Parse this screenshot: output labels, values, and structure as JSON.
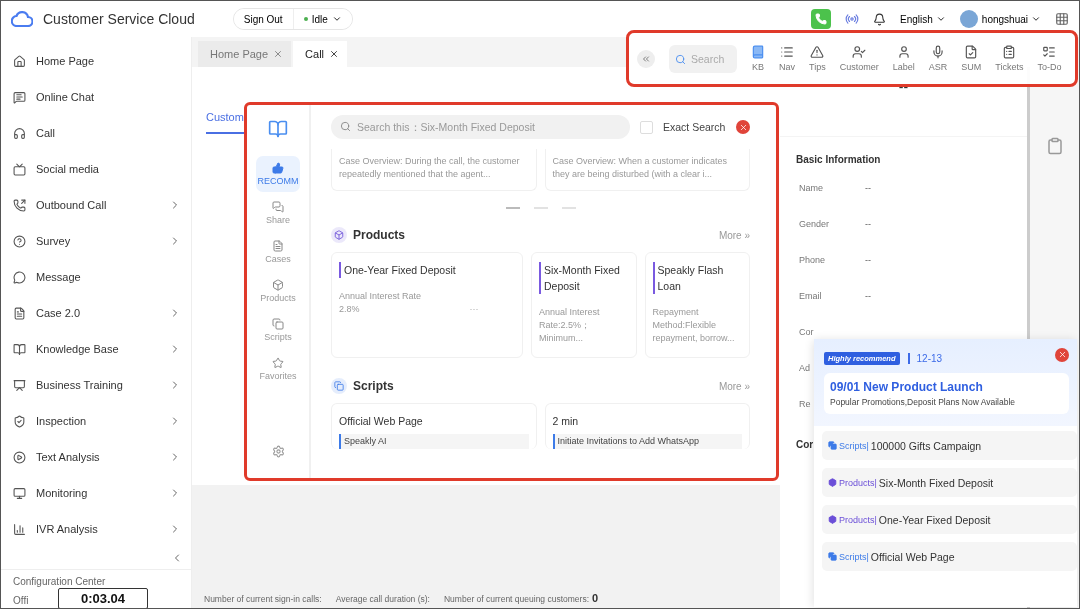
{
  "app": {
    "title": "Customer Service Cloud",
    "sign_out": "Sign Out",
    "status": "Idle",
    "language": "English",
    "user": "hongshuai"
  },
  "sidebar": {
    "items": [
      {
        "label": "Home Page",
        "expandable": false
      },
      {
        "label": "Online Chat",
        "expandable": false
      },
      {
        "label": "Call",
        "expandable": false
      },
      {
        "label": "Social media",
        "expandable": false
      },
      {
        "label": "Outbound Call",
        "expandable": true
      },
      {
        "label": "Survey",
        "expandable": true
      },
      {
        "label": "Message",
        "expandable": false
      },
      {
        "label": "Case 2.0",
        "expandable": true
      },
      {
        "label": "Knowledge Base",
        "expandable": true
      },
      {
        "label": "Business Training",
        "expandable": true
      },
      {
        "label": "Inspection",
        "expandable": true
      },
      {
        "label": "Text Analysis",
        "expandable": true
      },
      {
        "label": "Monitoring",
        "expandable": true
      },
      {
        "label": "IVR Analysis",
        "expandable": true
      }
    ],
    "bottom_items": [
      "Configuration Center",
      "Offi"
    ]
  },
  "tabs": [
    {
      "label": "Home Page",
      "selected": false
    },
    {
      "label": "Call",
      "selected": true
    }
  ],
  "workspace": {
    "tab": "Custom"
  },
  "stats": [
    {
      "label": "Number of current sign-in calls:"
    },
    {
      "label": "Average call duration (s):"
    },
    {
      "label": "Number of current queuing customers:",
      "value": "0"
    }
  ],
  "toolbar": {
    "search": {
      "placeholder": "Search"
    },
    "items": [
      {
        "label": "KB",
        "selected": true
      },
      {
        "label": "Nav",
        "selected": false
      },
      {
        "label": "Tips",
        "selected": false
      },
      {
        "label": "Customer",
        "selected": false
      },
      {
        "label": "Label",
        "selected": false
      },
      {
        "label": "ASR",
        "selected": false
      },
      {
        "label": "SUM",
        "selected": false
      },
      {
        "label": "Tickets",
        "selected": false
      },
      {
        "label": "To-Do",
        "selected": false
      }
    ]
  },
  "knowledge": {
    "nav": [
      {
        "label": "RECOMM",
        "selected": true
      },
      {
        "label": "Share",
        "selected": false
      },
      {
        "label": "Cases",
        "selected": false
      },
      {
        "label": "Products",
        "selected": false
      },
      {
        "label": "Scripts",
        "selected": false
      },
      {
        "label": "Favorites",
        "selected": false
      }
    ],
    "search": {
      "placeholder": "Search this：Six-Month Fixed Deposit"
    },
    "exact_search": {
      "label": "Exact Search",
      "checked": false
    },
    "cases": [
      {
        "text": "Case Overview: During the call, the customer repeatedly mentioned that the agent..."
      },
      {
        "text": "Case Overview: When a customer indicates they are being disturbed (with a clear i..."
      }
    ],
    "carousel": [
      {
        "selected": true
      },
      {
        "selected": false
      },
      {
        "selected": false
      }
    ],
    "sections": [
      {
        "title": "Products",
        "more": "More »",
        "kind": "products",
        "cards": [
          {
            "title": "One-Year Fixed Deposit",
            "text": "Annual Interest Rate\n2.8%",
            "extra": "···"
          },
          {
            "title": "Six-Month Fixed Deposit",
            "text": "Annual Interest Rate:2.5%；Minimum..."
          },
          {
            "title": "Speakly Flash Loan",
            "text": "Repayment Method:Flexible repayment, borrow..."
          }
        ]
      },
      {
        "title": "Scripts",
        "more": "More »",
        "kind": "scripts",
        "cards": [
          {
            "title": "Official Web Page",
            "text": "Speakly AI"
          },
          {
            "title": "2 min",
            "text": "Initiate Invitations to Add WhatsApp"
          }
        ]
      }
    ]
  },
  "customer": {
    "header": "--",
    "section": "Basic Information",
    "fields": [
      {
        "label": "Name",
        "value": "--"
      },
      {
        "label": "Gender",
        "value": "--"
      },
      {
        "label": "Phone",
        "value": "--"
      },
      {
        "label": "Email",
        "value": "--"
      },
      {
        "label": "Cor"
      },
      {
        "label": "Ad"
      },
      {
        "label": "Re"
      }
    ],
    "section_2": "Cor"
  },
  "recommend": {
    "badge": "Highly recommend",
    "date": "12-13",
    "title": "09/01 New Product Launch",
    "subtitle": "Popular Promotions,Deposit Plans Now Available",
    "items": [
      {
        "kind": "scripts",
        "category": "Scripts|",
        "title": "100000 Gifts Campaign"
      },
      {
        "kind": "products",
        "category": "Products|",
        "title": "Six-Month Fixed Deposit"
      },
      {
        "kind": "products",
        "category": "Products|",
        "title": "One-Year Fixed Deposit"
      },
      {
        "kind": "scripts",
        "category": "Scripts|",
        "title": "Official Web Page"
      }
    ]
  },
  "timer": "0:03.04"
}
